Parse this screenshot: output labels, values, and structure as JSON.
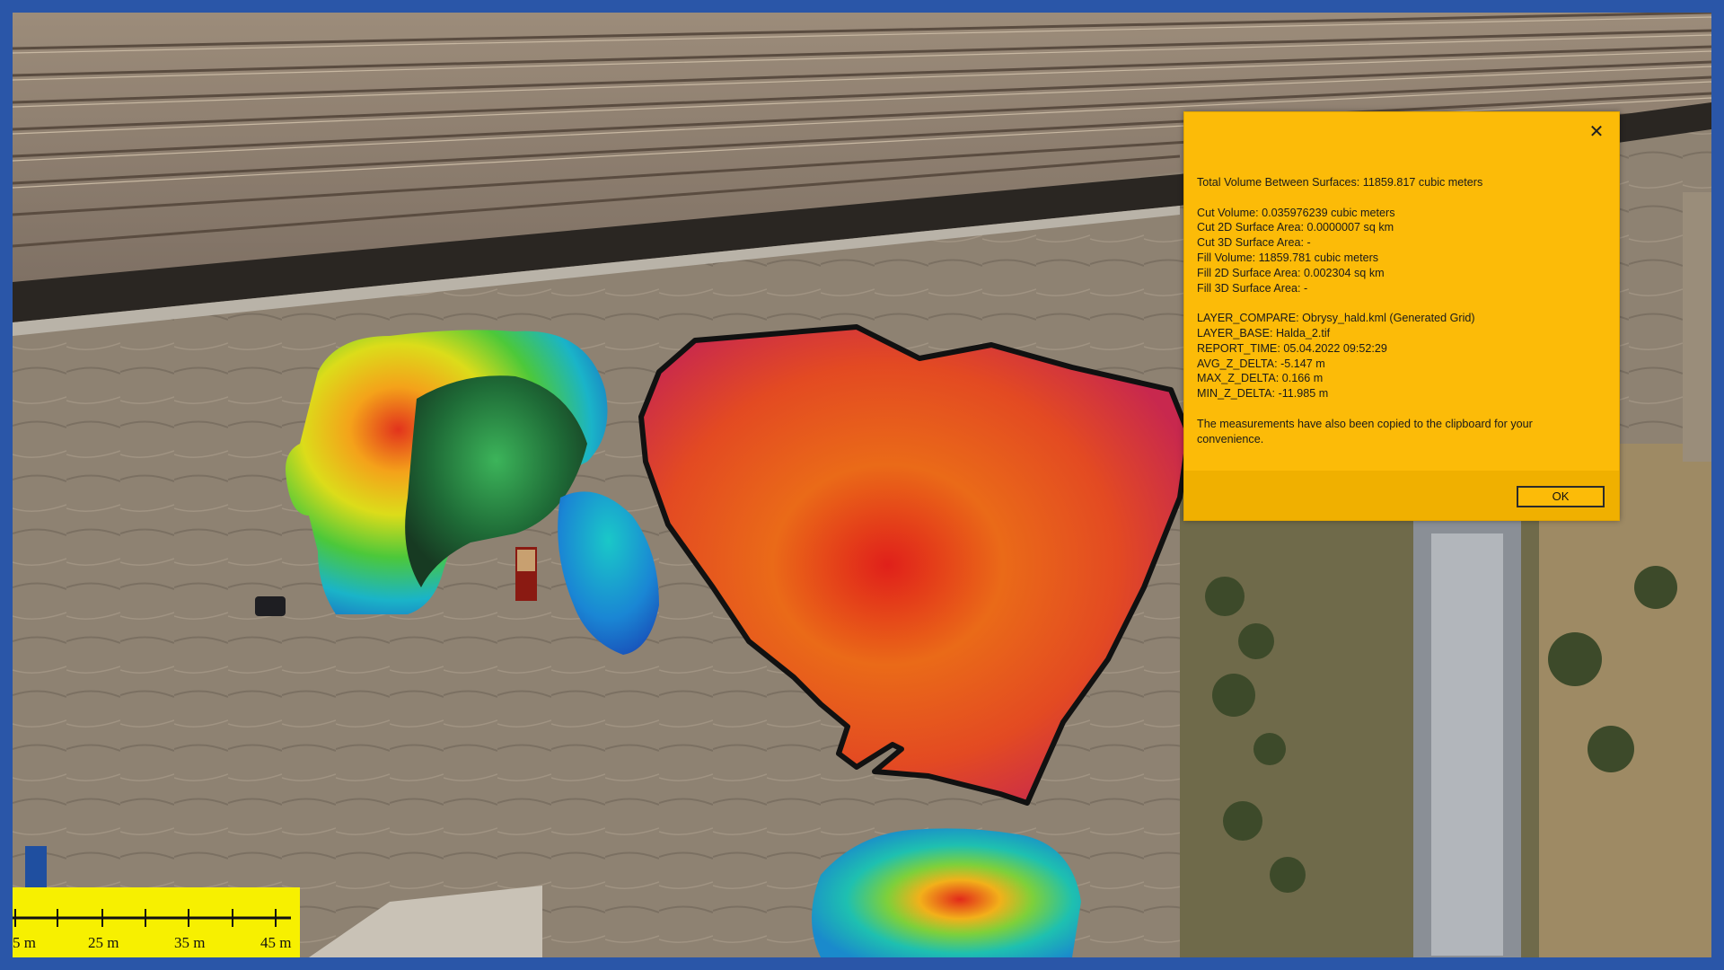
{
  "dialog": {
    "close_glyph": "✕",
    "total_volume": "Total Volume Between Surfaces: 11859.817 cubic meters",
    "cut_volume": "Cut Volume: 0.035976239 cubic meters",
    "cut_2d": "Cut 2D Surface Area: 0.0000007 sq km",
    "cut_3d": "Cut 3D Surface Area: -",
    "fill_volume": "Fill Volume: 11859.781 cubic meters",
    "fill_2d": "Fill 2D Surface Area: 0.002304 sq km",
    "fill_3d": "Fill 3D Surface Area: -",
    "layer_compare": "LAYER_COMPARE: Obrysy_hald.kml (Generated Grid)",
    "layer_base": "LAYER_BASE: Halda_2.tif",
    "report_time": "REPORT_TIME: 05.04.2022 09:52:29",
    "avg_z": "AVG_Z_DELTA: -5.147 m",
    "max_z": "MAX_Z_DELTA: 0.166 m",
    "min_z": "MIN_Z_DELTA: -11.985 m",
    "note": "The measurements have also been copied to the clipboard for your convenience.",
    "ok_label": "OK"
  },
  "scalebar": {
    "labels": [
      "5 m",
      "25 m",
      "35 m",
      "45 m"
    ]
  },
  "colors": {
    "frame": "#2a56a8",
    "dialog_bg": "#fcbb08",
    "scalebar_bg": "#f7f000"
  }
}
